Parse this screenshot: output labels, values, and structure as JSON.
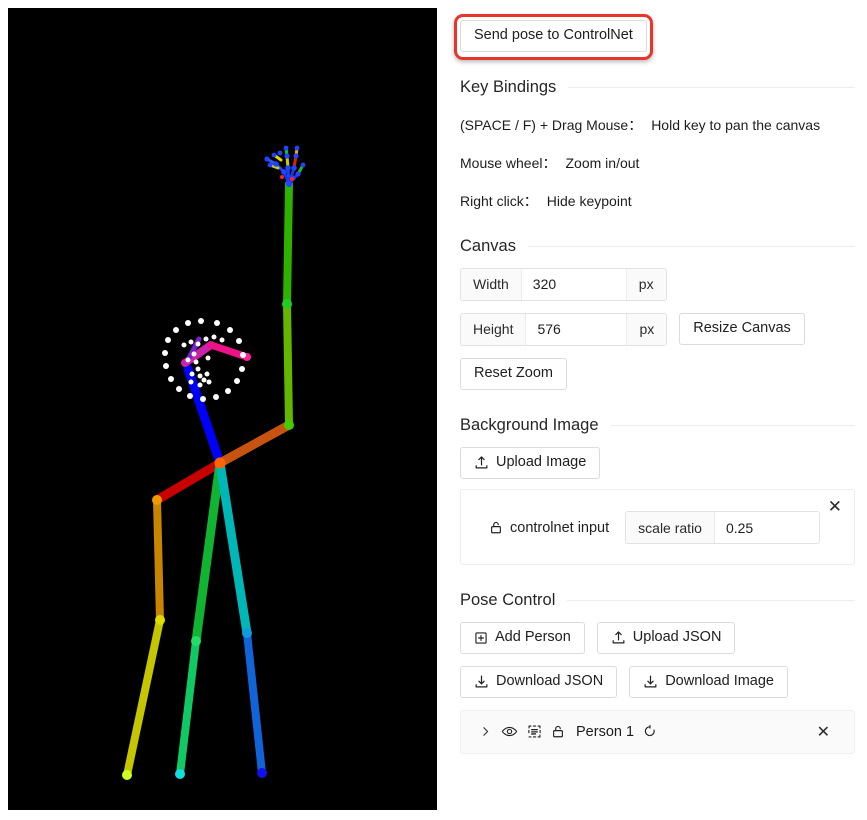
{
  "send_button": {
    "label": "Send pose to ControlNet",
    "highlight_color": "#e8352b"
  },
  "key_bindings": {
    "title": "Key Bindings",
    "rows": [
      {
        "key": "(SPACE / F) + Drag Mouse",
        "sep": "：",
        "value": "Hold key to pan the canvas"
      },
      {
        "key": "Mouse wheel",
        "sep": "：",
        "value": "Zoom in/out"
      },
      {
        "key": "Right click",
        "sep": "：",
        "value": "Hide keypoint"
      }
    ]
  },
  "canvas": {
    "title": "Canvas",
    "width_label": "Width",
    "width_value": "320",
    "height_label": "Height",
    "height_value": "576",
    "unit": "px",
    "resize_label": "Resize Canvas",
    "reset_zoom_label": "Reset Zoom"
  },
  "background_image": {
    "title": "Background Image",
    "upload_label": "Upload Image",
    "item_name": "controlnet input",
    "scale_ratio_label": "scale ratio",
    "scale_ratio_value": "0.25",
    "close_label": "✕"
  },
  "pose_control": {
    "title": "Pose Control",
    "add_person_label": "Add Person",
    "upload_json_label": "Upload JSON",
    "download_json_label": "Download JSON",
    "download_image_label": "Download Image",
    "person": {
      "name": "Person 1",
      "close_label": "✕"
    }
  },
  "pose_canvas": {
    "background": "#000000",
    "description": "OpenPose skeleton of a standing person with right arm raised, face keypoints and left hand keypoints visible"
  }
}
